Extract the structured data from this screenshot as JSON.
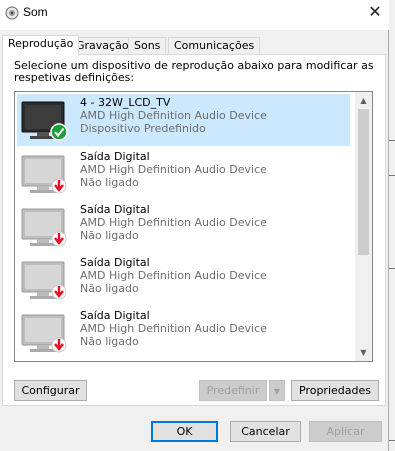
{
  "window": {
    "title": "Som",
    "close_glyph": "✕"
  },
  "tabs": [
    {
      "label": "Reprodução",
      "active": true
    },
    {
      "label": "Gravação",
      "active": false
    },
    {
      "label": "Sons",
      "active": false
    },
    {
      "label": "Comunicações",
      "active": false
    }
  ],
  "instructions": "Selecione um dispositivo de reprodução abaixo para modificar as respetivas definições:",
  "devices": [
    {
      "name": "4 - 32W_LCD_TV",
      "driver": "AMD High Definition Audio Device",
      "status": "Dispositivo Predefinido",
      "icon": "monitor-default-check-icon",
      "selected": true
    },
    {
      "name": "Saída Digital",
      "driver": "AMD High Definition Audio Device",
      "status": "Não ligado",
      "icon": "monitor-disconnected-icon",
      "selected": false
    },
    {
      "name": "Saída Digital",
      "driver": "AMD High Definition Audio Device",
      "status": "Não ligado",
      "icon": "monitor-disconnected-icon",
      "selected": false
    },
    {
      "name": "Saída Digital",
      "driver": "AMD High Definition Audio Device",
      "status": "Não ligado",
      "icon": "monitor-disconnected-icon",
      "selected": false
    },
    {
      "name": "Saída Digital",
      "driver": "AMD High Definition Audio Device",
      "status": "Não ligado",
      "icon": "monitor-disconnected-icon",
      "selected": false
    }
  ],
  "buttons": {
    "configure": "Configurar",
    "set_default": "Predefinir",
    "properties": "Propriedades",
    "ok": "OK",
    "cancel": "Cancelar",
    "apply": "Aplicar"
  },
  "colors": {
    "selection": "#cce8ff",
    "default_check": "#1aa035",
    "disconnected_arrow": "#e81123",
    "accent": "#0078d7"
  }
}
